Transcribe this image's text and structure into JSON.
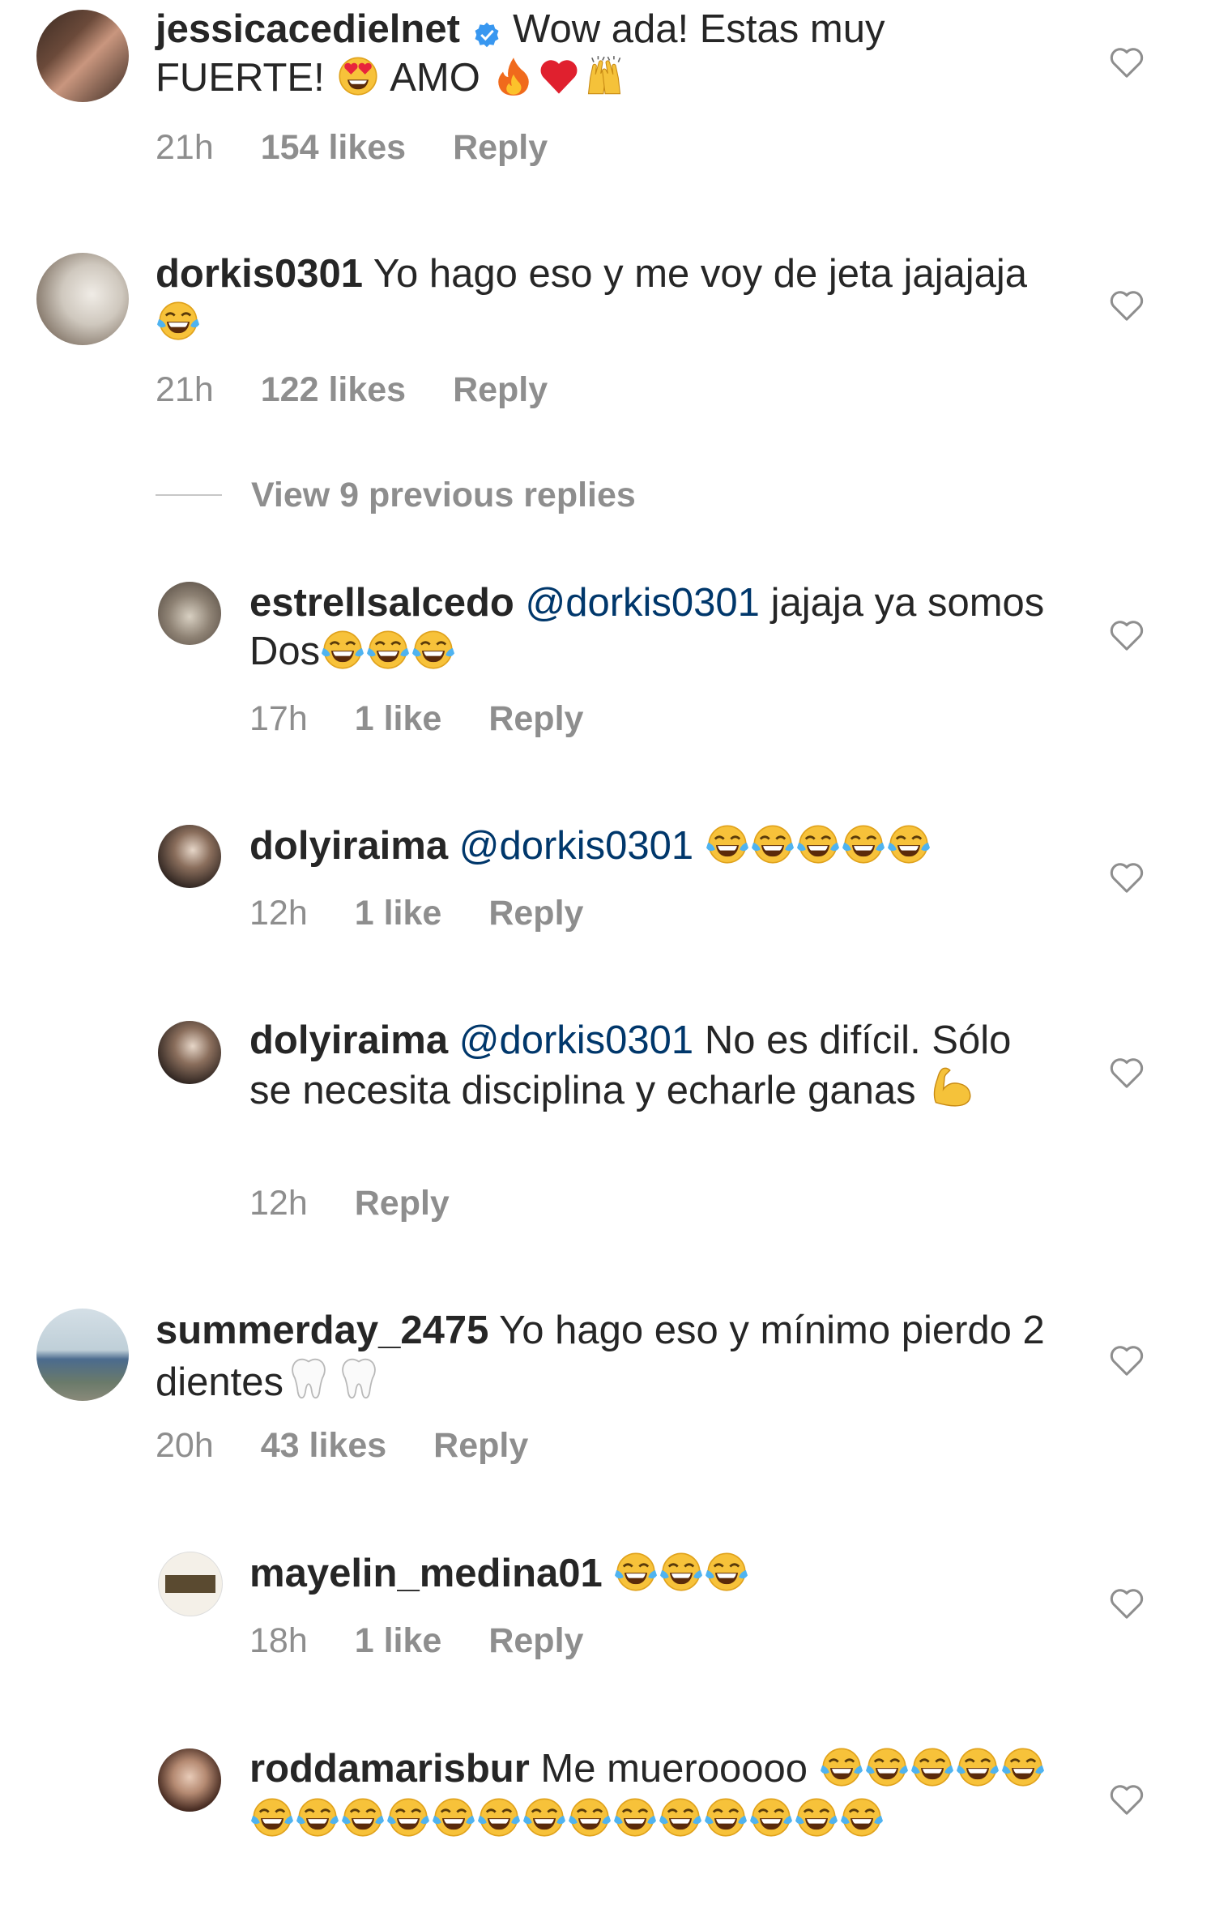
{
  "comments": [
    {
      "user": "jessicacedielnet",
      "verified": true,
      "text": " Wow ada! Estas muy FUERTE! ",
      "text2": " AMO ",
      "time": "21h",
      "likes": "154 likes",
      "reply": "Reply"
    },
    {
      "user": "dorkis0301",
      "text": " Yo hago eso y me voy de jeta jajajaja ",
      "time": "21h",
      "likes": "122 likes",
      "reply": "Reply"
    },
    {
      "user": "summerday_2475",
      "text": " Yo hago eso y mínimo pierdo 2 dientes",
      "time": "20h",
      "likes": "43 likes",
      "reply": "Reply"
    },
    {
      "user": "roddamarisbur",
      "text": " Me muerooooo "
    }
  ],
  "view_replies": "View 9 previous replies",
  "replies": [
    {
      "user": "estrellsalcedo",
      "mention": "@dorkis0301",
      "text": " jajaja ya somos Dos",
      "time": "17h",
      "likes": "1 like",
      "reply": "Reply"
    },
    {
      "user": "dolyiraima",
      "mention": "@dorkis0301",
      "text": " ",
      "time": "12h",
      "likes": "1 like",
      "reply": "Reply"
    },
    {
      "user": "dolyiraima",
      "mention": "@dorkis0301",
      "text": "  No es difícil. Sólo se necesita disciplina y echarle ganas ",
      "time": "12h",
      "reply": "Reply"
    },
    {
      "user": "mayelin_medina01",
      "text": " ",
      "time": "18h",
      "likes": "1 like",
      "reply": "Reply"
    }
  ],
  "icons": {
    "verified": "verified-badge-icon",
    "heart": "heart-outline-icon",
    "laugh": "tears-of-joy-emoji",
    "heart_eyes": "heart-eyes-emoji",
    "fire": "fire-emoji",
    "red_heart": "red-heart-emoji",
    "raised_hands": "raised-hands-emoji",
    "tooth": "tooth-emoji",
    "muscle": "flexed-biceps-emoji"
  },
  "colors": {
    "text": "#262626",
    "meta": "#8e8e8e",
    "mention": "#00376b",
    "verified": "#3897f0"
  }
}
